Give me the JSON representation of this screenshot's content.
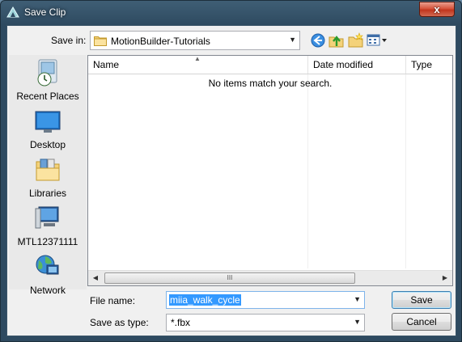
{
  "window": {
    "title": "Save Clip",
    "close_glyph": "x"
  },
  "save_in": {
    "label": "Save in:",
    "folder": "MotionBuilder-Tutorials",
    "folder_icon": "folder-icon",
    "dropdown_glyph": "▼"
  },
  "toolbar": {
    "icons": [
      "back-icon",
      "up-folder-icon",
      "new-folder-icon",
      "view-menu-icon"
    ]
  },
  "places": [
    {
      "label": "Recent Places",
      "icon": "recent-places-icon"
    },
    {
      "label": "Desktop",
      "icon": "desktop-icon"
    },
    {
      "label": "Libraries",
      "icon": "libraries-icon"
    },
    {
      "label": "MTL12371111",
      "icon": "computer-icon"
    },
    {
      "label": "Network",
      "icon": "network-icon"
    }
  ],
  "file_list": {
    "columns": [
      "Name",
      "Date modified",
      "Type"
    ],
    "sort_glyph": "▲",
    "empty_message": "No items match your search.",
    "scroll_left_glyph": "◀",
    "scroll_right_glyph": "▶",
    "scroll_grip_glyph": "III"
  },
  "file_name": {
    "label": "File name:",
    "value": "miia_walk_cycle",
    "dropdown_glyph": "▼"
  },
  "save_as_type": {
    "label": "Save as type:",
    "value": "*.fbx",
    "dropdown_glyph": "▼"
  },
  "buttons": {
    "save": "Save",
    "cancel": "Cancel"
  },
  "colors": {
    "titlebar": "#3f5e75",
    "close_button": "#c1351d",
    "selection": "#3399ff",
    "default_button_border": "#3c7fb1"
  }
}
